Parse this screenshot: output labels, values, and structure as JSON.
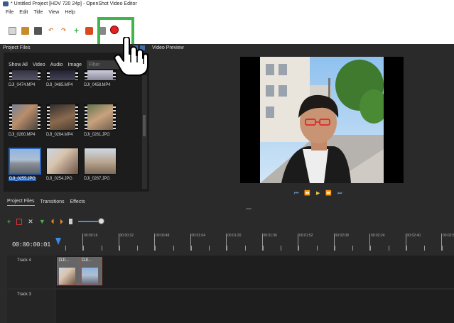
{
  "window": {
    "title": "* Untitled Project [HDV 720 24p] - OpenShot Video Editor"
  },
  "menu": [
    "File",
    "Edit",
    "Title",
    "View",
    "Help"
  ],
  "colors": {
    "highlight": "#3fb54a",
    "record": "#e02424",
    "accent": "#2a63b8",
    "panel_bg": "#2a2a2a"
  },
  "project_files": {
    "header": "Project Files",
    "filters": [
      "Show All",
      "Video",
      "Audio",
      "Image"
    ],
    "filter_placeholder": "Filter",
    "items": [
      {
        "label": "DJI_0474.MP4",
        "kind": "video"
      },
      {
        "label": "DJI_0485.MP4",
        "kind": "video"
      },
      {
        "label": "DJI_0458.MP4",
        "kind": "video"
      },
      {
        "label": "DJI_0260.MP4",
        "kind": "video"
      },
      {
        "label": "DJI_0264.MP4",
        "kind": "video"
      },
      {
        "label": "DJI_0261.JPG",
        "kind": "image"
      },
      {
        "label": "DJI_0255.JPG",
        "kind": "image",
        "selected": true
      },
      {
        "label": "DJI_0254.JPG",
        "kind": "image"
      },
      {
        "label": "DJI_0267.JPG",
        "kind": "image"
      }
    ]
  },
  "video_preview": {
    "header": "Video Preview"
  },
  "lower_tabs": [
    "Project Files",
    "Transitions",
    "Effects"
  ],
  "timeline": {
    "timecode": "00:00:00:01",
    "ruler_labels": [
      "00:00:16",
      "00:00:32",
      "00:00:48",
      "00:01:04",
      "00:01:20",
      "00:01:36",
      "00:01:52",
      "00:02:08",
      "00:02:24",
      "00:02:40",
      "00:02:56"
    ],
    "tracks": [
      {
        "name": "Track 4",
        "clips": [
          {
            "title": "DJI..."
          },
          {
            "title": "DJI..."
          }
        ]
      },
      {
        "name": "Track 3",
        "clips": []
      }
    ]
  }
}
